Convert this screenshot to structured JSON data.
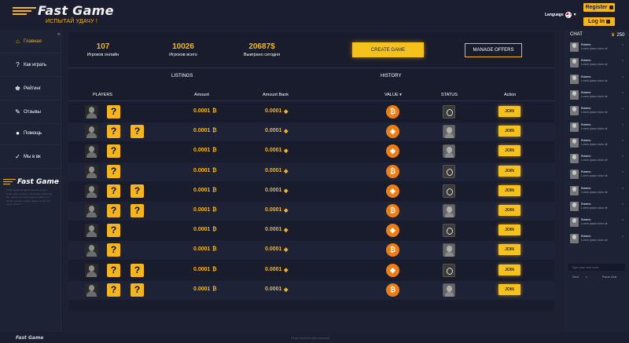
{
  "header": {
    "logo": "Fast Game",
    "tagline": "ИСПЫТАЙ УДАЧУ !",
    "language_label": "Language",
    "register_label": "Register",
    "login_label": "Log In"
  },
  "sidebar": {
    "items": [
      {
        "label": "Главная",
        "icon": "home-icon"
      },
      {
        "label": "Как играть",
        "icon": "question-icon"
      },
      {
        "label": "Рейтинг",
        "icon": "rating-icon"
      },
      {
        "label": "Отзывы",
        "icon": "reviews-icon"
      },
      {
        "label": "Помощь",
        "icon": "help-icon"
      },
      {
        "label": "Мы в вк",
        "icon": "vk-icon"
      }
    ],
    "logo": "Fast Game",
    "about_text": "©Fast Game All rights reserved. Lorem ipsum dolor sit amet, consectetur adipiscing elit, sed do eiusmod tempor incididunt ut labore et dolore magna aliqua. Ut enim ad minim veniam."
  },
  "stats": [
    {
      "value": "107",
      "label": "Игроков онлайн"
    },
    {
      "value": "10026",
      "label": "Игроков всего"
    },
    {
      "value": "20687$",
      "label": "Выиграно сегодня"
    }
  ],
  "buttons": {
    "create_game": "CREATE GAME",
    "manage_offers": "MANAGE OFFERS",
    "join": "JOIN"
  },
  "tabs": {
    "listings": "LISTINGS",
    "history": "HISTORY"
  },
  "table": {
    "headers": {
      "players": "PLAYERS",
      "amount": "Amount",
      "amount_bank": "Amount Bank",
      "value": "VALUE",
      "status": "STATUS",
      "action": "Action"
    },
    "rows": [
      {
        "amount": "0.0001",
        "bank": "0.0001",
        "extra_slot": false,
        "coin": "btc",
        "status": "dark"
      },
      {
        "amount": "0.0001",
        "bank": "0.0001",
        "extra_slot": true,
        "coin": "eth",
        "status": "face"
      },
      {
        "amount": "0.0001",
        "bank": "0.0001",
        "extra_slot": false,
        "coin": "eth",
        "status": "face"
      },
      {
        "amount": "0.0001",
        "bank": "0.0001",
        "extra_slot": false,
        "coin": "btc",
        "status": "dark"
      },
      {
        "amount": "0.0001",
        "bank": "0.0001",
        "extra_slot": true,
        "coin": "eth",
        "status": "dark"
      },
      {
        "amount": "0.0001",
        "bank": "0.0001",
        "extra_slot": true,
        "coin": "btc",
        "status": "face"
      },
      {
        "amount": "0.0001",
        "bank": "0.0001",
        "extra_slot": false,
        "coin": "eth",
        "status": "dark"
      },
      {
        "amount": "0.0001",
        "bank": "0.0001",
        "extra_slot": false,
        "coin": "btc",
        "status": "face"
      },
      {
        "amount": "0.0001",
        "bank": "0.0001",
        "extra_slot": true,
        "coin": "eth",
        "status": "dark"
      },
      {
        "amount": "0.0001",
        "bank": "0.0001",
        "extra_slot": true,
        "coin": "btc",
        "status": "face"
      }
    ]
  },
  "chat": {
    "title": "CHAT",
    "online": "250",
    "messages": [
      {
        "name": "Roberto",
        "text": "Lorem ipsum dolor sit"
      },
      {
        "name": "Roberto",
        "text": "Lorem ipsum dolor sit"
      },
      {
        "name": "Roberto",
        "text": "Lorem ipsum dolor sit"
      },
      {
        "name": "Roberto",
        "text": "Lorem ipsum dolor sit"
      },
      {
        "name": "Roberto",
        "text": "Lorem ipsum dolor sit"
      },
      {
        "name": "Roberto",
        "text": "Lorem ipsum dolor sit"
      },
      {
        "name": "Roberto",
        "text": "Lorem ipsum dolor sit"
      },
      {
        "name": "Roberto",
        "text": "Lorem ipsum dolor sit"
      },
      {
        "name": "Roberto",
        "text": "Lorem ipsum dolor sit"
      },
      {
        "name": "Roberto",
        "text": "Lorem ipsum dolor sit"
      },
      {
        "name": "Roberto",
        "text": "Lorem ipsum dolor sit"
      },
      {
        "name": "Roberto",
        "text": "Lorem ipsum dolor sit"
      },
      {
        "name": "Roberto",
        "text": "Lorem ipsum dolor sit"
      }
    ],
    "input_placeholder": "Type your text here...",
    "send_label": "Send",
    "pause_label": "Pause Chat"
  },
  "footer": {
    "logo": "Fast Game",
    "copyright": "©Fast Game All rights reserved"
  },
  "colors": {
    "accent": "#f5b51b",
    "background": "#1d2033",
    "panel": "#191c2d"
  }
}
